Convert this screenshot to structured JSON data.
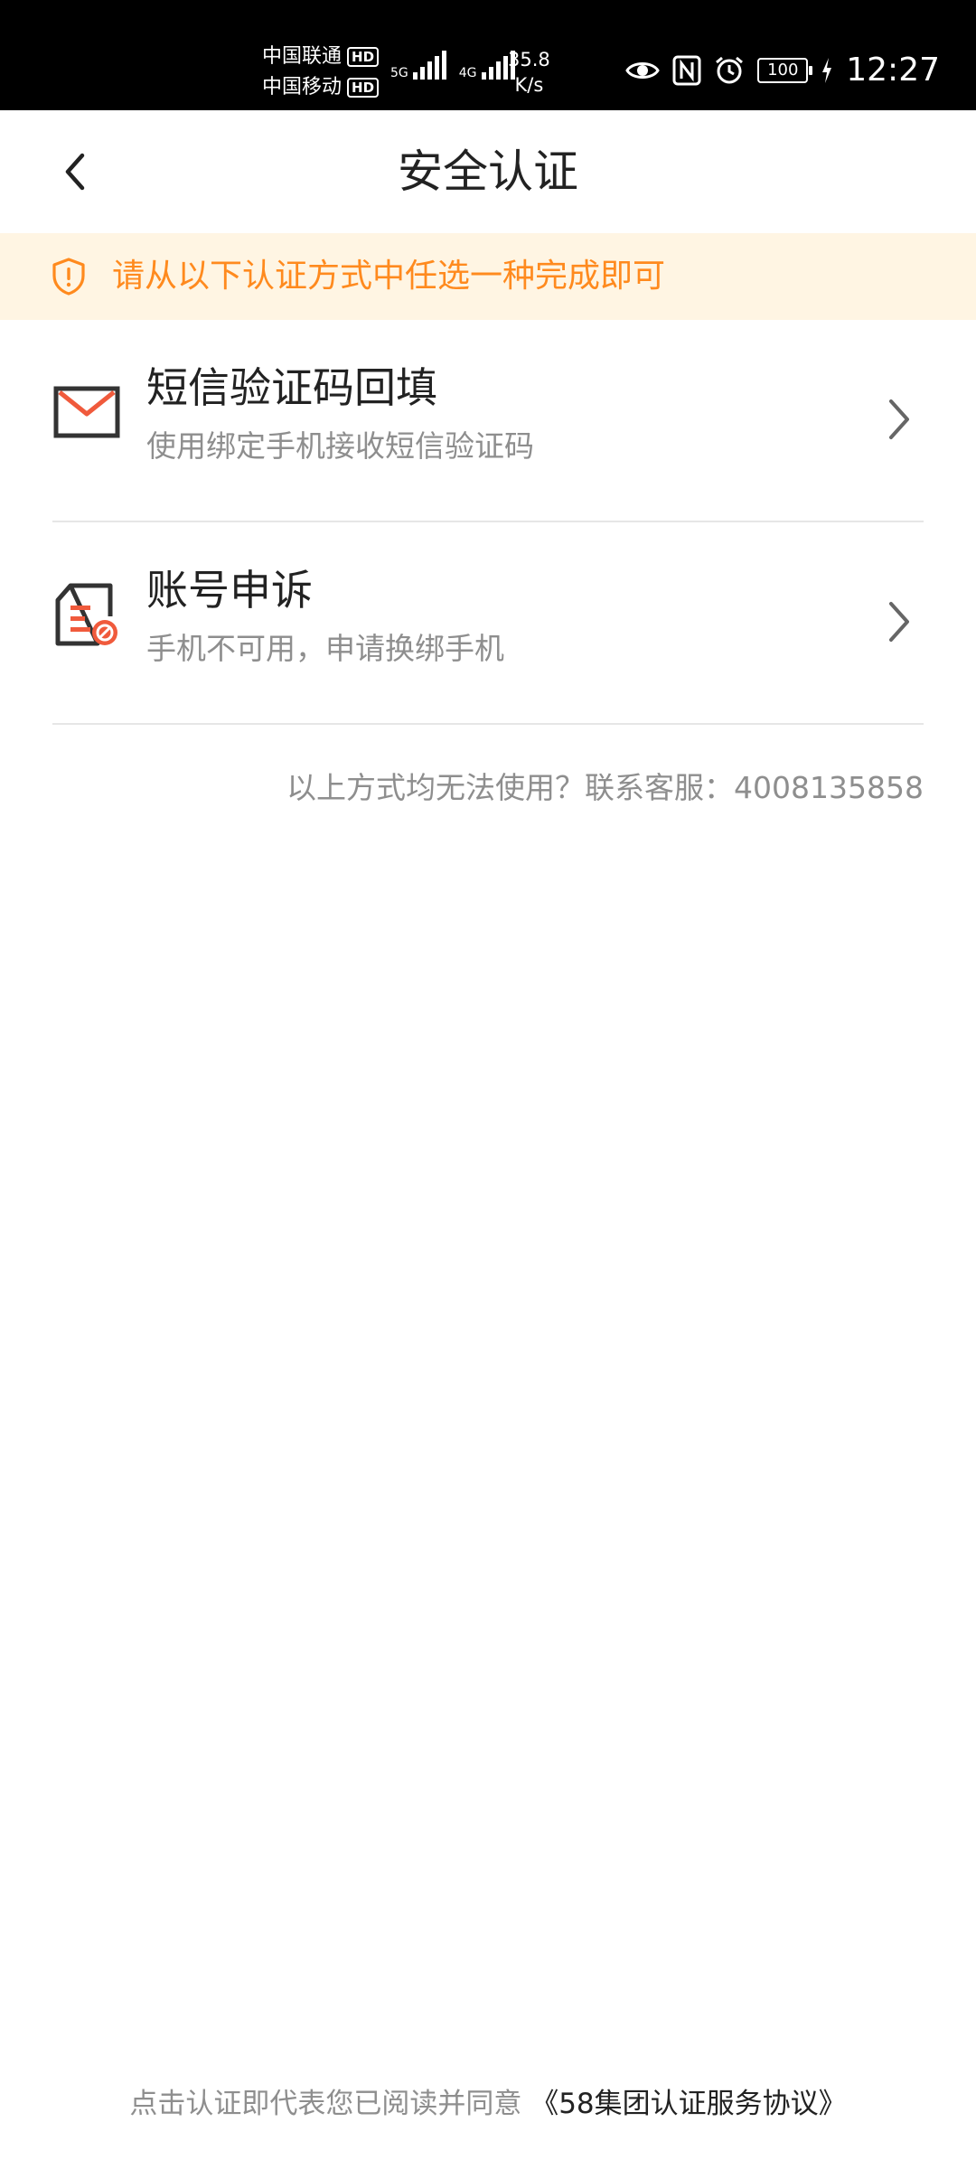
{
  "status_bar": {
    "carrier_1": "中国联通",
    "carrier_2": "中国移动",
    "hd_badge": "HD",
    "sig1_label": "5G",
    "sig2_label": "4G",
    "net_speed_value": "35.8",
    "net_speed_unit": "K/s",
    "battery": "100",
    "time": "12:27",
    "icons": [
      "eye-icon",
      "nfc-icon",
      "alarm-icon",
      "battery-icon",
      "charging-icon"
    ]
  },
  "nav": {
    "title": "安全认证",
    "back_icon": "chevron-left-icon"
  },
  "notice": {
    "icon": "shield-alert-icon",
    "text": "请从以下认证方式中任选一种完成即可"
  },
  "options": [
    {
      "icon": "envelope-icon",
      "title": "短信验证码回填",
      "desc": "使用绑定手机接收短信验证码"
    },
    {
      "icon": "document-ban-icon",
      "title": "账号申诉",
      "desc": "手机不可用，申请换绑手机"
    }
  ],
  "help": {
    "text": "以上方式均无法使用？联系客服：",
    "phone": "4008135858"
  },
  "agreement": {
    "text": "点击认证即代表您已阅读并同意 ",
    "link": "《58集团认证服务协议》"
  },
  "colors": {
    "accent": "#ff8a1e",
    "notice_bg": "#fff5e3",
    "icon_red": "#f05a3c",
    "icon_dark": "#333333",
    "text_secondary": "#8e8e8e"
  }
}
